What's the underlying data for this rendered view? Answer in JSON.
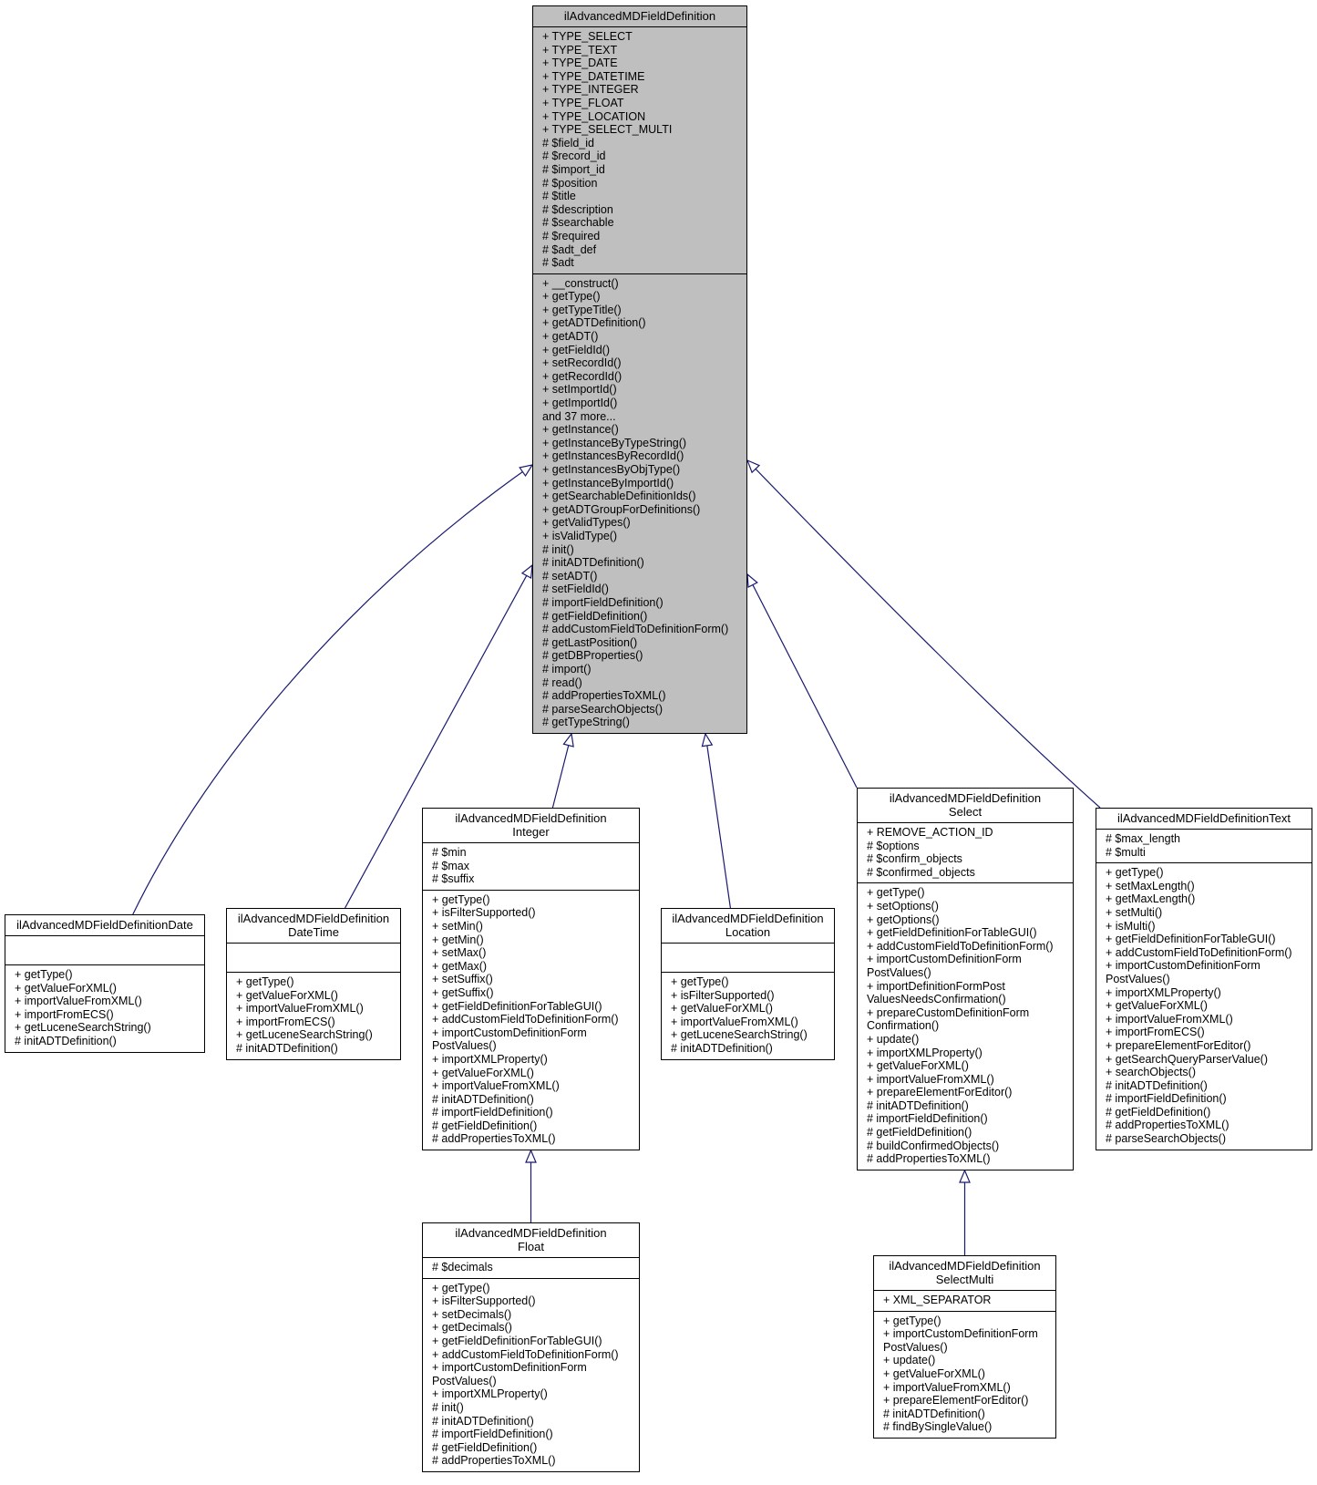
{
  "diagram": {
    "type": "class-inheritance",
    "edge_color": "#191970",
    "base_fill": "#bfbfbf",
    "classes": {
      "base": {
        "title": [
          "ilAdvancedMDFieldDefinition"
        ],
        "attributes": [
          "+ TYPE_SELECT",
          "+ TYPE_TEXT",
          "+ TYPE_DATE",
          "+ TYPE_DATETIME",
          "+ TYPE_INTEGER",
          "+ TYPE_FLOAT",
          "+ TYPE_LOCATION",
          "+ TYPE_SELECT_MULTI",
          "# $field_id",
          "# $record_id",
          "# $import_id",
          "# $position",
          "# $title",
          "# $description",
          "# $searchable",
          "# $required",
          "# $adt_def",
          "# $adt"
        ],
        "methods": [
          "+ __construct()",
          "+ getType()",
          "+ getTypeTitle()",
          "+ getADTDefinition()",
          "+ getADT()",
          "+ getFieldId()",
          "+ setRecordId()",
          "+ getRecordId()",
          "+ setImportId()",
          "+ getImportId()",
          "and 37 more...",
          "+ getInstance()",
          "+ getInstanceByTypeString()",
          "+ getInstancesByRecordId()",
          "+ getInstancesByObjType()",
          "+ getInstanceByImportId()",
          "+ getSearchableDefinitionIds()",
          "+ getADTGroupForDefinitions()",
          "+ getValidTypes()",
          "+ isValidType()",
          "# init()",
          "# initADTDefinition()",
          "# setADT()",
          "# setFieldId()",
          "# importFieldDefinition()",
          "# getFieldDefinition()",
          "# addCustomFieldToDefinitionForm()",
          "# getLastPosition()",
          "# getDBProperties()",
          "# import()",
          "# read()",
          "# addPropertiesToXML()",
          "# parseSearchObjects()",
          "# getTypeString()"
        ]
      },
      "date": {
        "title": [
          "ilAdvancedMDFieldDefinitionDate"
        ],
        "attributes": [],
        "methods": [
          "+ getType()",
          "+ getValueForXML()",
          "+ importValueFromXML()",
          "+ importFromECS()",
          "+ getLuceneSearchString()",
          "# initADTDefinition()"
        ]
      },
      "datetime": {
        "title": [
          "ilAdvancedMDFieldDefinition",
          "DateTime"
        ],
        "attributes": [],
        "methods": [
          "+ getType()",
          "+ getValueForXML()",
          "+ importValueFromXML()",
          "+ importFromECS()",
          "+ getLuceneSearchString()",
          "# initADTDefinition()"
        ]
      },
      "integer": {
        "title": [
          "ilAdvancedMDFieldDefinition",
          "Integer"
        ],
        "attributes": [
          "# $min",
          "# $max",
          "# $suffix"
        ],
        "methods": [
          "+ getType()",
          "+ isFilterSupported()",
          "+ setMin()",
          "+ getMin()",
          "+ setMax()",
          "+ getMax()",
          "+ setSuffix()",
          "+ getSuffix()",
          "+ getFieldDefinitionForTableGUI()",
          "+ addCustomFieldToDefinitionForm()",
          "+ importCustomDefinitionForm",
          "PostValues()",
          "+ importXMLProperty()",
          "+ getValueForXML()",
          "+ importValueFromXML()",
          "# initADTDefinition()",
          "# importFieldDefinition()",
          "# getFieldDefinition()",
          "# addPropertiesToXML()"
        ]
      },
      "location": {
        "title": [
          "ilAdvancedMDFieldDefinition",
          "Location"
        ],
        "attributes": [],
        "methods": [
          "+ getType()",
          "+ isFilterSupported()",
          "+ getValueForXML()",
          "+ importValueFromXML()",
          "+ getLuceneSearchString()",
          "# initADTDefinition()"
        ]
      },
      "select": {
        "title": [
          "ilAdvancedMDFieldDefinition",
          "Select"
        ],
        "attributes": [
          "+ REMOVE_ACTION_ID",
          "# $options",
          "# $confirm_objects",
          "# $confirmed_objects"
        ],
        "methods": [
          "+ getType()",
          "+ setOptions()",
          "+ getOptions()",
          "+ getFieldDefinitionForTableGUI()",
          "+ addCustomFieldToDefinitionForm()",
          "+ importCustomDefinitionForm",
          "PostValues()",
          "+ importDefinitionFormPost",
          "ValuesNeedsConfirmation()",
          "+ prepareCustomDefinitionForm",
          "Confirmation()",
          "+ update()",
          "+ importXMLProperty()",
          "+ getValueForXML()",
          "+ importValueFromXML()",
          "+ prepareElementForEditor()",
          "# initADTDefinition()",
          "# importFieldDefinition()",
          "# getFieldDefinition()",
          "# buildConfirmedObjects()",
          "# addPropertiesToXML()"
        ]
      },
      "text": {
        "title": [
          "ilAdvancedMDFieldDefinitionText"
        ],
        "attributes": [
          "# $max_length",
          "# $multi"
        ],
        "methods": [
          "+ getType()",
          "+ setMaxLength()",
          "+ getMaxLength()",
          "+ setMulti()",
          "+ isMulti()",
          "+ getFieldDefinitionForTableGUI()",
          "+ addCustomFieldToDefinitionForm()",
          "+ importCustomDefinitionForm",
          "PostValues()",
          "+ importXMLProperty()",
          "+ getValueForXML()",
          "+ importValueFromXML()",
          "+ importFromECS()",
          "+ prepareElementForEditor()",
          "+ getSearchQueryParserValue()",
          "+ searchObjects()",
          "# initADTDefinition()",
          "# importFieldDefinition()",
          "# getFieldDefinition()",
          "# addPropertiesToXML()",
          "# parseSearchObjects()"
        ]
      },
      "float": {
        "title": [
          "ilAdvancedMDFieldDefinition",
          "Float"
        ],
        "attributes": [
          "# $decimals"
        ],
        "methods": [
          "+ getType()",
          "+ isFilterSupported()",
          "+ setDecimals()",
          "+ getDecimals()",
          "+ getFieldDefinitionForTableGUI()",
          "+ addCustomFieldToDefinitionForm()",
          "+ importCustomDefinitionForm",
          "PostValues()",
          "+ importXMLProperty()",
          "# init()",
          "# initADTDefinition()",
          "# importFieldDefinition()",
          "# getFieldDefinition()",
          "# addPropertiesToXML()"
        ]
      },
      "selectmulti": {
        "title": [
          "ilAdvancedMDFieldDefinition",
          "SelectMulti"
        ],
        "attributes": [
          "+ XML_SEPARATOR"
        ],
        "methods": [
          "+ getType()",
          "+ importCustomDefinitionForm",
          "PostValues()",
          "+ update()",
          "+ getValueForXML()",
          "+ importValueFromXML()",
          "+ prepareElementForEditor()",
          "# initADTDefinition()",
          "# findBySingleValue()"
        ]
      }
    },
    "inheritance": [
      {
        "child": "date",
        "parent": "base"
      },
      {
        "child": "datetime",
        "parent": "base"
      },
      {
        "child": "integer",
        "parent": "base"
      },
      {
        "child": "location",
        "parent": "base"
      },
      {
        "child": "select",
        "parent": "base"
      },
      {
        "child": "text",
        "parent": "base"
      },
      {
        "child": "float",
        "parent": "integer"
      },
      {
        "child": "selectmulti",
        "parent": "select"
      }
    ]
  }
}
